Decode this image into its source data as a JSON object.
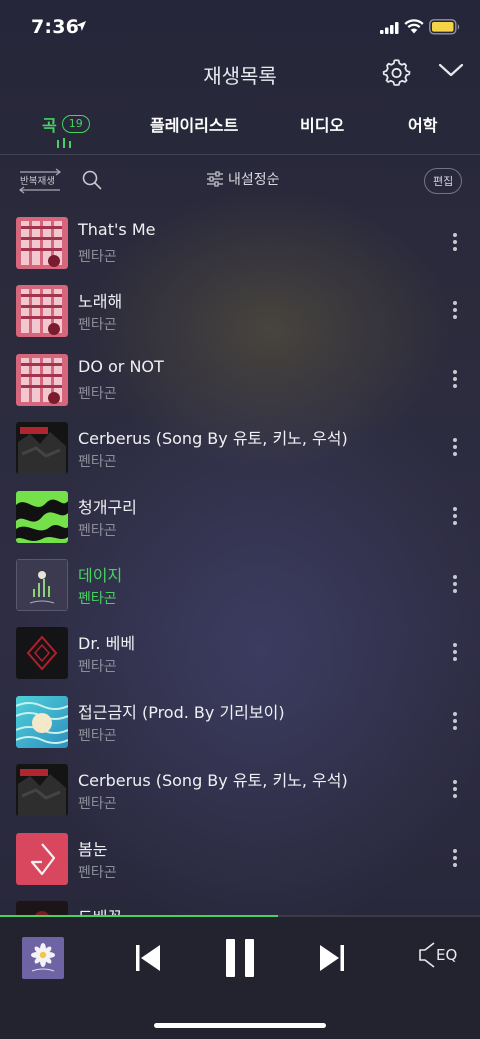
{
  "status_bar": {
    "time": "7:36"
  },
  "header": {
    "title": "재생목록"
  },
  "tabs": [
    {
      "label": "곡",
      "count": "19",
      "active": true
    },
    {
      "label": "플레이리스트"
    },
    {
      "label": "비디오"
    },
    {
      "label": "어학"
    }
  ],
  "controls": {
    "repeat_label": "반복재생",
    "sort_label": "내설정순",
    "edit_label": "편집"
  },
  "songs": [
    {
      "title": "That's Me",
      "artist": "펜타곤"
    },
    {
      "title": "노래해",
      "artist": "펜타곤"
    },
    {
      "title": "DO or NOT",
      "artist": "펜타곤"
    },
    {
      "title": "Cerberus (Song By 유토, 키노, 우석)",
      "artist": "펜타곤"
    },
    {
      "title": "청개구리",
      "artist": "펜타곤"
    },
    {
      "title": "데이지",
      "artist": "펜타곤",
      "playing": true
    },
    {
      "title": "Dr. 베베",
      "artist": "펜타곤"
    },
    {
      "title": "접근금지 (Prod. By 기리보이)",
      "artist": "펜타곤"
    },
    {
      "title": "Cerberus (Song By 유토, 키노, 우석)",
      "artist": "펜타곤"
    },
    {
      "title": "봄눈",
      "artist": "펜타곤"
    },
    {
      "title": "도배꽃",
      "artist": ""
    }
  ],
  "player": {
    "progress": 0.58,
    "eq_label": "EQ"
  },
  "colors": {
    "accent": "#47d162",
    "background": "#2b2b3c",
    "player_bg": "#23232f"
  },
  "icons": [
    "location-arrow-icon",
    "signal-icon",
    "wifi-icon",
    "battery-icon",
    "gear-icon",
    "chevron-down-icon",
    "search-icon",
    "sliders-icon",
    "more-vertical-icon",
    "previous-icon",
    "pause-icon",
    "next-icon",
    "speaker-icon"
  ]
}
